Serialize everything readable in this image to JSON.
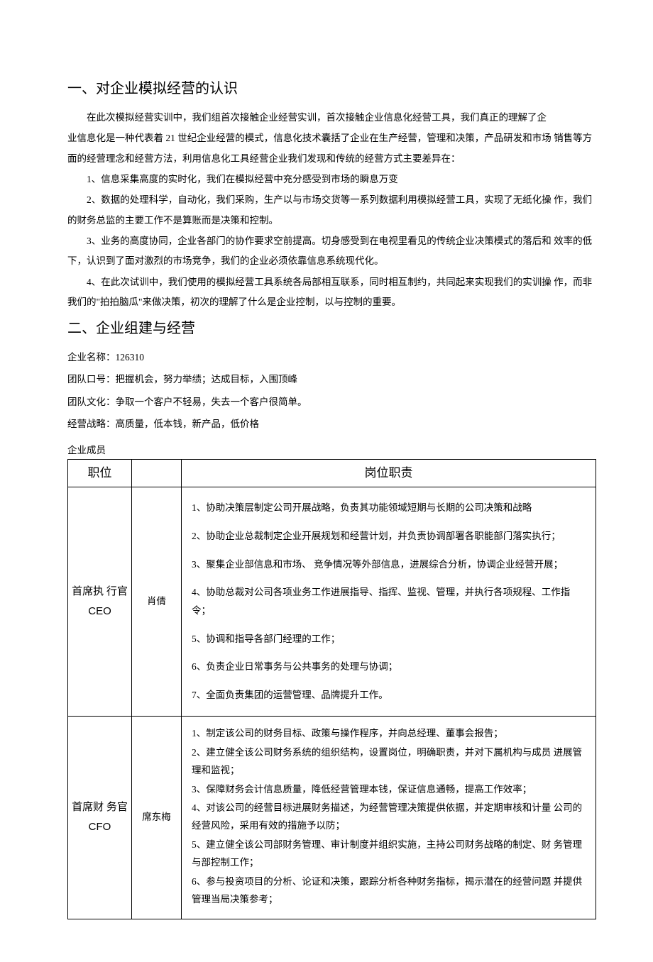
{
  "section1": {
    "title": "一、对企业模拟经营的认识",
    "p1a": "在此次模拟经营实训中，我们组首次接触企业经营实训，首次接触企业信息化经营工具，我们真正的理解了企",
    "p1b": "业信息化是一种代表着 21 世纪企业经营的模式，信息化技术囊括了企业在生产经营，管理和决策，产品研发和市场 销售等方面的经营理念和经营方法，利用信息化工具经营企业我们发现和传统的经营方式主要差异在：",
    "p2": "1、信息采集高度的实时化，我们在模拟经营中充分感受到市场的瞬息万变",
    "p3": "2、数据的处理科学，自动化，我们采购，生产以与市场交货等一系列数据利用模拟经营工具，实现了无纸化操 作，我们的财务总监的主要工作不是算账而是决策和控制。",
    "p4": "3、业务的高度协同，企业各部门的协作要求空前提高。切身感受到在电视里看见的传统企业决策模式的落后和 效率的低下，认识到了面对激烈的市场竞争，我们的企业必须依靠信息系统现代化。",
    "p5": "4、在此次试训中，我们使用的模拟经营工具系统各局部相互联系，同时相互制约，共同起来实现我们的实训操 作，而非我们的\"拍拍脑瓜\"来做决策，初次的理解了什么是企业控制，以与控制的重要。"
  },
  "section2": {
    "title": "二、企业组建与经营",
    "company_name_label": "企业名称：",
    "company_name_value": "126310",
    "slogan": "团队口号：把握机会，努力举绩；达成目标，入围顶峰",
    "culture": "团队文化：争取一个客户不轻易，失去一个客户很简单。",
    "strategy": "经营战略：高质量，低本钱，新产品，低价格",
    "members_label": "企业成员",
    "table_header_pos": "职位",
    "table_header_name": "",
    "table_header_duty": "岗位职责",
    "rows": [
      {
        "position_cn1": "首席执 行官",
        "position_en": "CEO",
        "name": "肖倩",
        "duties": [
          "1、协助决策层制定公司开展战略，负责其功能领域短期与长期的公司决策和战略",
          "2、协助企业总裁制定企业开展规划和经营计划，并负责协调部署各职能部门落实执行；",
          "3、聚集企业部信息和市场、 竞争情况等外部信息，进展综合分析，协调企业经营开展；",
          "4、协助总裁对公司各项业务工作进展指导、指挥、监视、管理，并执行各项规程、工作指令；",
          "5、协调和指导各部门经理的工作；",
          "6、负责企业日常事务与公共事务的处理与协调；",
          "7、全面负责集团的运营管理、品牌提升工作。"
        ]
      },
      {
        "position_cn1": "首席财 务官",
        "position_en": "CFO",
        "name": "席东梅",
        "duties": [
          "1、制定该公司的财务目标、政策与操作程序，并向总经理、董事会报告；",
          "2、建立健全该公司财务系统的组织结构，设置岗位，明确职责，并对下属机构与成员 进展管理和监视；",
          "3、保障财务会计信息质量，降低经营管理本钱，保证信息通畅，提高工作效率；",
          "4、对该公司的经营目标进展财务描述，为经营管理决策提供依据，并定期审核和计量 公司的经营风险，采用有效的措施予以防；",
          "5、建立健全该公司部财务管理、审计制度并组织实施，主持公司财务战略的制定、财 务管理与部控制工作；",
          "6、参与投资项目的分析、论证和决策，跟踪分析各种财务指标，揭示潜在的经营问题 并提供管理当局决策参考；"
        ]
      }
    ]
  }
}
